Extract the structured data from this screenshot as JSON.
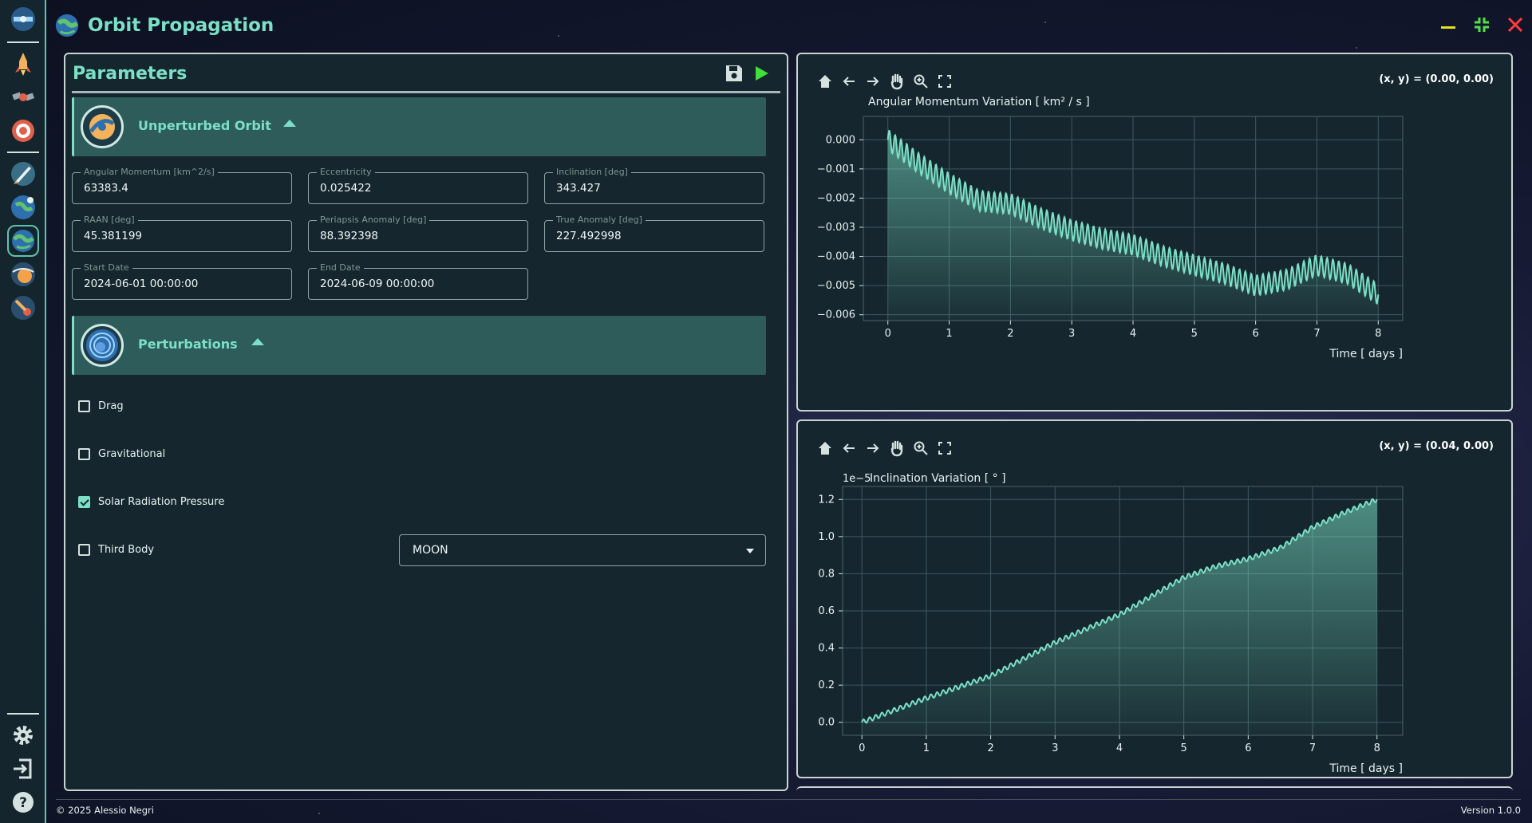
{
  "app": {
    "title": "Orbit Propagation",
    "footer_left": "© 2025 Alessio Negri",
    "footer_right": "Version 1.0.0"
  },
  "sidebar": {
    "items": [
      {
        "icon": "satellite-logo-icon"
      },
      {
        "icon": "rocket-launch-icon"
      },
      {
        "icon": "satellite-icon"
      },
      {
        "icon": "target-icon"
      },
      {
        "icon": "rocket-icon"
      },
      {
        "icon": "earth-transfer-icon"
      },
      {
        "icon": "orbit-propagation-icon",
        "active": true
      },
      {
        "icon": "planet-flyby-icon"
      },
      {
        "icon": "comet-icon"
      },
      {
        "icon": "gear-icon"
      },
      {
        "icon": "logout-icon"
      },
      {
        "icon": "help-icon"
      }
    ]
  },
  "params": {
    "title": "Parameters",
    "unperturbed": {
      "label": "Unperturbed Orbit",
      "fields": [
        {
          "label": "Angular Momentum [km^2/s]",
          "value": "63383.4"
        },
        {
          "label": "Eccentricity",
          "value": "0.025422"
        },
        {
          "label": "Inclination [deg]",
          "value": "343.427"
        },
        {
          "label": "RAAN [deg]",
          "value": "45.381199"
        },
        {
          "label": "Periapsis Anomaly [deg]",
          "value": "88.392398"
        },
        {
          "label": "True Anomaly [deg]",
          "value": "227.492998"
        },
        {
          "label": "Start Date",
          "value": "2024-06-01 00:00:00"
        },
        {
          "label": "End Date",
          "value": "2024-06-09 00:00:00"
        }
      ]
    },
    "perturbations": {
      "label": "Perturbations",
      "options": [
        {
          "label": "Drag",
          "checked": false
        },
        {
          "label": "Gravitational",
          "checked": false
        },
        {
          "label": "Solar Radiation Pressure",
          "checked": true
        },
        {
          "label": "Third Body",
          "checked": false
        }
      ],
      "third_body_select": "MOON"
    }
  },
  "plots": {
    "p1": {
      "coord": "(x, y) = (0.00, 0.00)"
    },
    "p2": {
      "coord": "(x, y) = (0.04, 0.00)"
    }
  },
  "chart_data": [
    {
      "type": "area",
      "title": "Angular Momentum Variation [ km² / s ]",
      "xlabel": "Time [ days ]",
      "ylabel": "",
      "xlim": [
        -0.4,
        8.4
      ],
      "ylim": [
        -0.0062,
        0.0008
      ],
      "xticks": [
        0,
        1,
        2,
        3,
        4,
        5,
        6,
        7,
        8
      ],
      "yticks": [
        "0.000",
        "−0.001",
        "−0.002",
        "−0.003",
        "−0.004",
        "−0.005",
        "−0.006"
      ],
      "ytick_values": [
        0.0,
        -0.001,
        -0.002,
        -0.003,
        -0.004,
        -0.005,
        -0.006
      ],
      "grid": true,
      "color": "#7be0c6",
      "oscillation_amplitude": 0.00035,
      "oscillations_per_day": 10.5,
      "trend": {
        "x": [
          0,
          0.5,
          1,
          1.5,
          2,
          2.5,
          3,
          3.5,
          4,
          4.5,
          5,
          5.5,
          6,
          6.5,
          7,
          7.5,
          8
        ],
        "y": [
          0.0,
          -0.0008,
          -0.0015,
          -0.0021,
          -0.0022,
          -0.0027,
          -0.0031,
          -0.0034,
          -0.0036,
          -0.004,
          -0.0043,
          -0.0046,
          -0.005,
          -0.0048,
          -0.0043,
          -0.0046,
          -0.0053
        ]
      }
    },
    {
      "type": "area",
      "title": "Inclination Variation [ ° ]",
      "offset_label": "1e−5",
      "xlabel": "Time [ days ]",
      "ylabel": "",
      "xlim": [
        -0.3,
        8.4
      ],
      "ylim": [
        -0.07,
        1.27
      ],
      "xticks": [
        0,
        1,
        2,
        3,
        4,
        5,
        6,
        7,
        8
      ],
      "yticks": [
        "0.0",
        "0.2",
        "0.4",
        "0.6",
        "0.8",
        "1.0",
        "1.2"
      ],
      "ytick_values": [
        0.0,
        0.2,
        0.4,
        0.6,
        0.8,
        1.0,
        1.2
      ],
      "grid": true,
      "color": "#7be0c6",
      "oscillation_amplitude": 0.012,
      "oscillations_per_day": 10.5,
      "trend": {
        "x": [
          0,
          1,
          2,
          3,
          4,
          4.5,
          5,
          5.5,
          6,
          6.5,
          7,
          7.5,
          8
        ],
        "y": [
          0.0,
          0.13,
          0.25,
          0.43,
          0.58,
          0.68,
          0.78,
          0.84,
          0.88,
          0.94,
          1.05,
          1.13,
          1.2
        ]
      }
    }
  ]
}
